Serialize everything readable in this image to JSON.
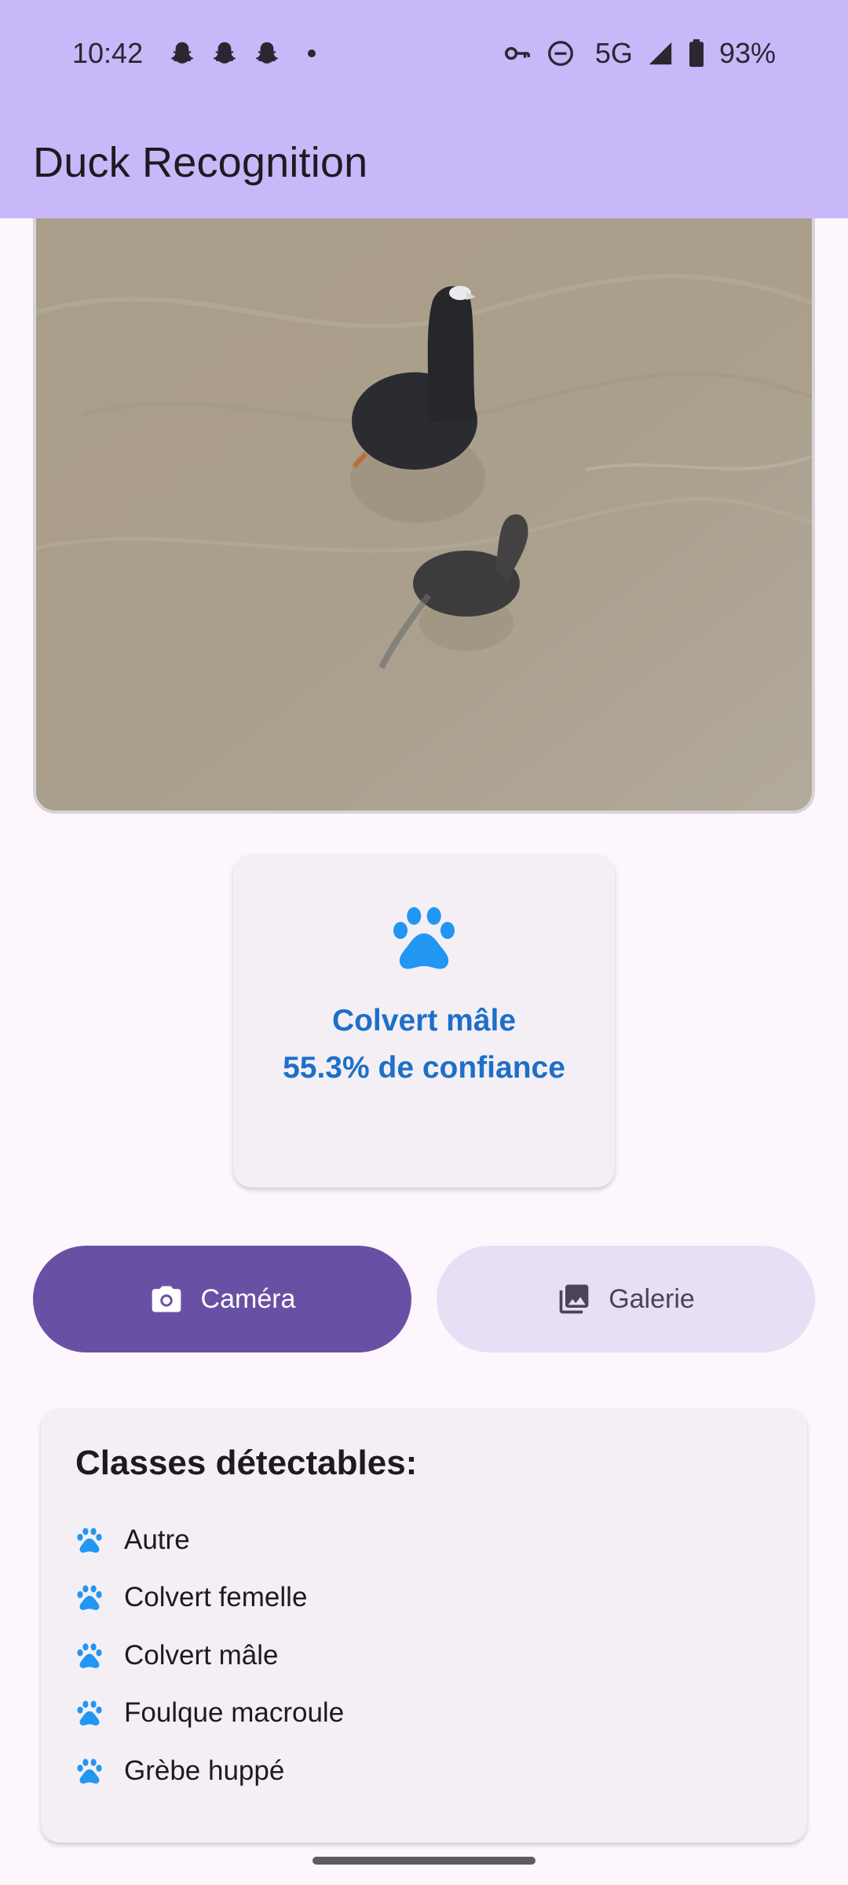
{
  "status_bar": {
    "time": "10:42",
    "network": "5G",
    "battery": "93%",
    "icons": [
      "snapchat-icon",
      "snapchat-icon",
      "snapchat-icon",
      "notification-dot",
      "vpn-key-icon",
      "do-not-disturb-icon",
      "signal-icon",
      "battery-icon"
    ]
  },
  "app_bar": {
    "title": "Duck Recognition"
  },
  "result": {
    "icon": "paw-icon",
    "label": "Colvert mâle",
    "confidence": "55.3% de confiance",
    "color": "#1d6fc9"
  },
  "buttons": {
    "camera": {
      "label": "Caméra",
      "icon": "camera-icon"
    },
    "gallery": {
      "label": "Galerie",
      "icon": "photo-library-icon"
    }
  },
  "classes": {
    "title": "Classes détectables:",
    "items": [
      "Autre",
      "Colvert femelle",
      "Colvert mâle",
      "Foulque macroule",
      "Grèbe huppé"
    ]
  },
  "colors": {
    "app_bar": "#c8b8fa",
    "primary": "#6851a5",
    "secondary_container": "#e8def6",
    "accent_blue": "#2196f3"
  }
}
